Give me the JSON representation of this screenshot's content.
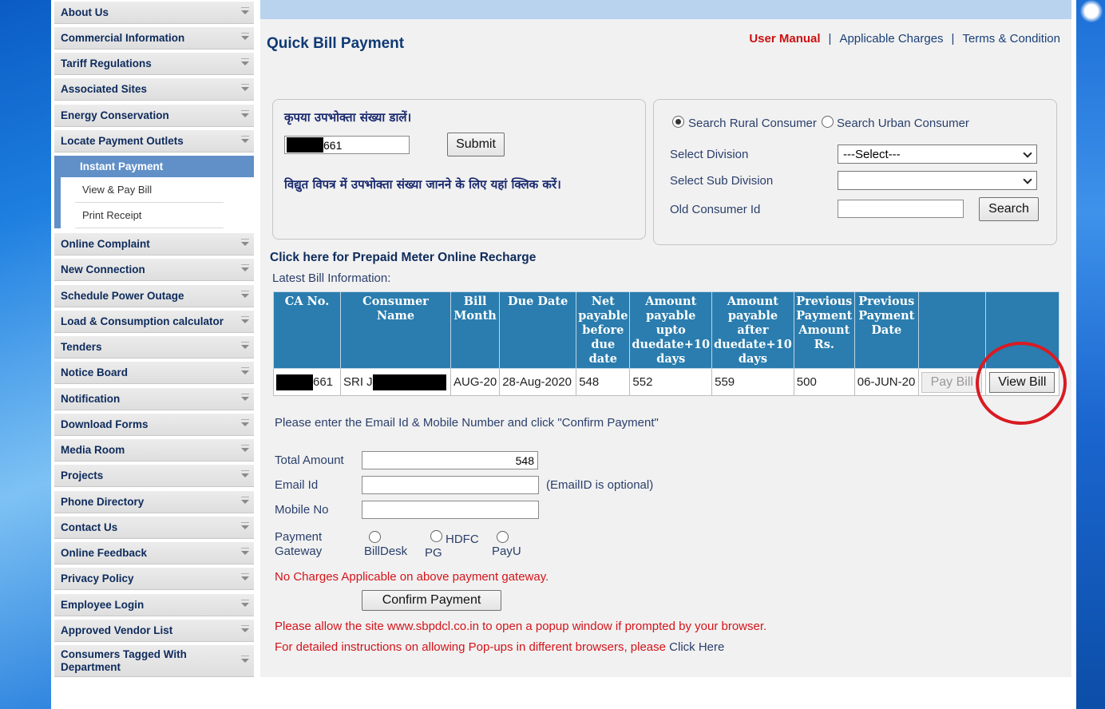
{
  "sidebar": {
    "items": [
      {
        "label": "About Us",
        "icon": "chevron-down-icon"
      },
      {
        "label": "Commercial Information",
        "icon": "chevron-down-icon"
      },
      {
        "label": "Tariff Regulations",
        "icon": "chevron-down-icon"
      },
      {
        "label": "Associated Sites",
        "icon": "chevron-down-icon"
      },
      {
        "label": "Energy Conservation",
        "icon": "chevron-down-icon"
      },
      {
        "label": "Locate Payment Outlets",
        "icon": "chevron-down-icon"
      },
      {
        "label": "Online Complaint",
        "icon": "chevron-down-icon"
      },
      {
        "label": "New Connection",
        "icon": "chevron-down-icon"
      },
      {
        "label": "Schedule Power Outage",
        "icon": "chevron-down-icon"
      },
      {
        "label": "Load & Consumption calculator",
        "icon": "chevron-down-icon"
      },
      {
        "label": "Tenders",
        "icon": "chevron-down-icon"
      },
      {
        "label": "Notice Board",
        "icon": "chevron-down-icon"
      },
      {
        "label": "Notification",
        "icon": "chevron-down-icon"
      },
      {
        "label": "Download Forms",
        "icon": "chevron-down-icon"
      },
      {
        "label": "Media Room",
        "icon": "chevron-down-icon"
      },
      {
        "label": "Projects",
        "icon": "chevron-down-icon"
      },
      {
        "label": "Phone Directory",
        "icon": "chevron-down-icon"
      },
      {
        "label": "Contact Us",
        "icon": "chevron-down-icon"
      },
      {
        "label": "Online Feedback",
        "icon": "chevron-down-icon"
      },
      {
        "label": "Privacy Policy",
        "icon": "chevron-down-icon"
      },
      {
        "label": "Employee Login",
        "icon": "chevron-down-icon"
      },
      {
        "label": "Approved Vendor List",
        "icon": "chevron-down-icon"
      },
      {
        "label": "Consumers Tagged With Department",
        "icon": "chevron-down-icon"
      }
    ],
    "active_group": {
      "label": "Instant Payment",
      "sub_items": [
        "View & Pay Bill",
        "Print Receipt"
      ]
    }
  },
  "header": {
    "title": "Quick Bill Payment",
    "links": {
      "user_manual": "User Manual",
      "charges": "Applicable Charges",
      "terms": "Terms & Condition",
      "separator": "|"
    }
  },
  "consumer_panel": {
    "prompt": "कृपया उपभोक्ता संख्या डालें।",
    "consumer_number_suffix": "661",
    "submit_label": "Submit",
    "help_text": "विद्युत विपत्र में उपभोक्ता संख्या जानने के लिए यहां क्लिक करें।"
  },
  "search_panel": {
    "rural_label": "Search Rural Consumer",
    "urban_label": "Search Urban Consumer",
    "selected": "rural",
    "division_label": "Select Division",
    "division_value": "---Select---",
    "subdivision_label": "Select Sub Division",
    "subdivision_value": "",
    "old_id_label": "Old Consumer Id",
    "old_id_value": "",
    "search_label": "Search"
  },
  "prepaid_link": "Click here for Prepaid Meter Online Recharge",
  "latest_bill_label": "Latest Bill Information:",
  "table": {
    "headers": [
      "CA No.",
      "Consumer Name",
      "Bill Month",
      "Due Date",
      "Net payable before due date",
      "Amount payable upto duedate+10 days",
      "Amount payable after duedate+10 days",
      "Previous Payment Amount Rs.",
      "Previous Payment Date"
    ],
    "row": {
      "ca_suffix": "661",
      "name_prefix": "SRI J",
      "bill_month": "AUG-20",
      "due_date": "28-Aug-2020",
      "net_payable": "548",
      "upto_10": "552",
      "after_10": "559",
      "prev_amount": "500",
      "prev_date": "06-JUN-20",
      "pay_label": "Pay Bill",
      "view_label": "View Bill"
    }
  },
  "payment": {
    "instruction": "Please enter the Email Id & Mobile Number and click \"Confirm Payment\"",
    "total_label": "Total Amount",
    "total_value": "548",
    "email_label": "Email Id",
    "email_note": "(EmailID is optional)",
    "mobile_label": "Mobile No",
    "gateway_label_1": "Payment",
    "gateway_label_2": "Gateway",
    "gateways": {
      "billdesk": "BillDesk",
      "hdfc_1": "HDFC",
      "hdfc_2": "PG",
      "payu": "PayU"
    },
    "no_charges": "No Charges Applicable on above payment gateway.",
    "confirm_label": "Confirm Payment",
    "popup_note": "Please allow the site www.sbpdcl.co.in to open a popup window if prompted by your browser.",
    "popup_help": "For detailed instructions on allowing Pop-ups in different browsers, please",
    "click_here": "Click Here"
  },
  "colors": {
    "table_header": "#2a7dae",
    "accent_red": "#d4141a",
    "active_menu": "#6190c8",
    "title": "#0e3a75"
  }
}
